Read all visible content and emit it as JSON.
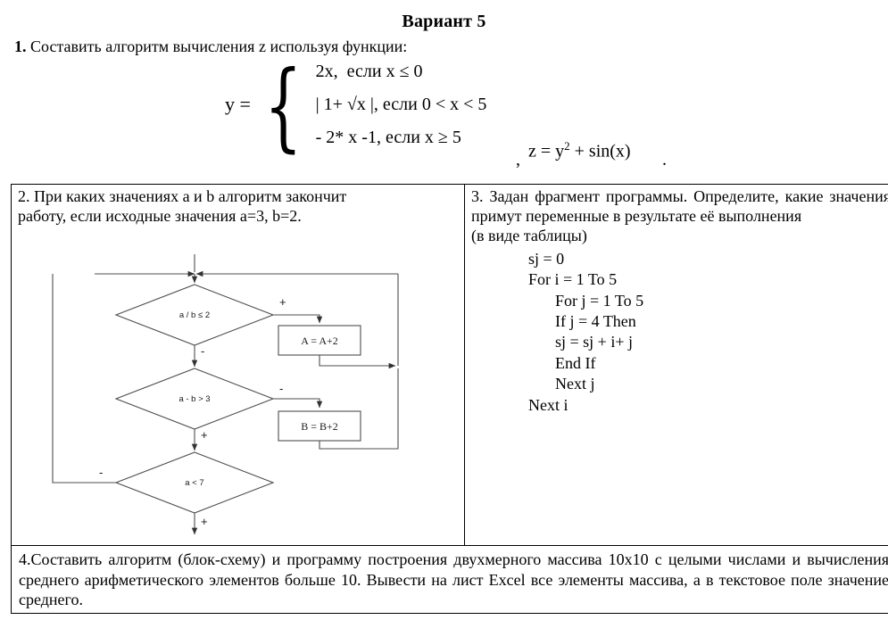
{
  "document": {
    "title": "Вариант 5"
  },
  "task1": {
    "number": "1.",
    "text": "Составить алгоритм вычисления z используя функции:",
    "formula": {
      "lhs": "y =",
      "cases": [
        {
          "expr": "2x,",
          "condition": "если x ≤ 0"
        },
        {
          "expr": "| 1+ √x |,",
          "condition": "если 0 < x < 5"
        },
        {
          "expr": "- 2* x -1,",
          "condition": "если x ≥ 5"
        }
      ],
      "z_expression": "z = y",
      "z_exponent": "2",
      "z_tail": "+ sin(x)",
      "leading_comma": ",",
      "trailing_period": "."
    }
  },
  "task2": {
    "text_line1": "2. При каких значениях a и b алгоритм закончит",
    "text_line2": "работу, если исходные значения a=3, b=2.",
    "flowchart": {
      "decisions": [
        {
          "id": "d1",
          "label": "a / b ≤ 2",
          "yes_sign": "+",
          "no_sign": "-"
        },
        {
          "id": "d2",
          "label": "a - b > 3",
          "right_sign": "-",
          "down_sign": "+"
        },
        {
          "id": "d3",
          "label": "a < 7",
          "left_sign": "-",
          "down_sign": "+"
        }
      ],
      "processes": [
        {
          "id": "p1",
          "label": "A = A+2"
        },
        {
          "id": "p2",
          "label": "B = B+2"
        }
      ]
    }
  },
  "task3": {
    "text": "3. Задан фрагмент программы. Определите, какие значения примут переменные в результате её выполнения",
    "subtext": "(в виде таблицы)",
    "code": [
      {
        "indent": 0,
        "text": "sj = 0"
      },
      {
        "indent": 0,
        "text": "For i = 1 To 5"
      },
      {
        "indent": 1,
        "text": "For j = 1 To 5"
      },
      {
        "indent": 1,
        "text": "If j = 4 Then"
      },
      {
        "indent": 1,
        "text": "sj = sj + i+ j"
      },
      {
        "indent": 1,
        "text": "End If"
      },
      {
        "indent": 1,
        "text": "Next j"
      },
      {
        "indent": 0,
        "text": "Next i"
      }
    ]
  },
  "task4": {
    "text": "4.Составить алгоритм (блок-схему) и программу построения двухмерного массива 10x10 с целыми числами и вычисления среднего арифметического элементов больше 10. Вывести на лист Excel все элементы массива, а в текстовое поле значение среднего."
  }
}
